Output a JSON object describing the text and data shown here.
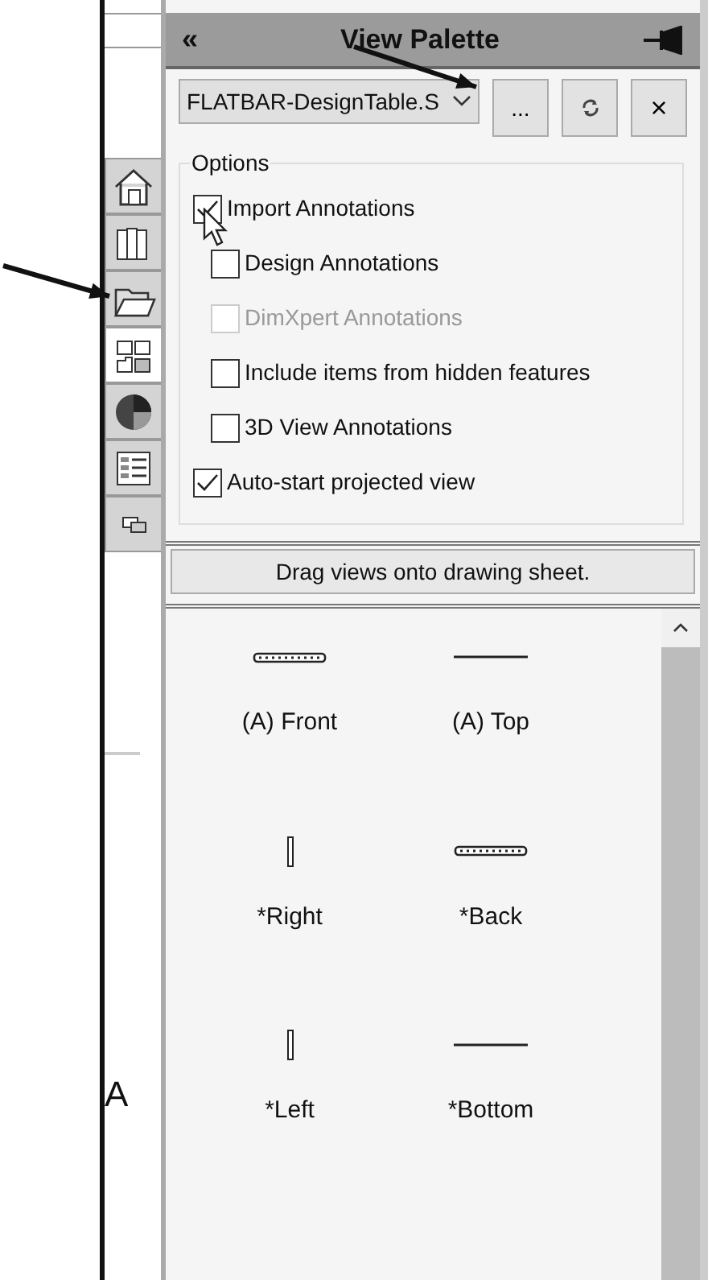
{
  "header": {
    "collapse": "«",
    "title": "View Palette"
  },
  "file_select": {
    "value": "FLATBAR-DesignTable.S"
  },
  "toolbar_buttons": [
    {
      "kind": "browse",
      "label": "..."
    },
    {
      "kind": "refresh"
    },
    {
      "kind": "close",
      "label": "×"
    }
  ],
  "side_tabs": [
    {
      "kind": "home",
      "selected": false
    },
    {
      "kind": "library",
      "selected": false
    },
    {
      "kind": "folder",
      "selected": false
    },
    {
      "kind": "palette",
      "selected": true
    },
    {
      "kind": "appearance",
      "selected": false
    },
    {
      "kind": "properties",
      "selected": false
    },
    {
      "kind": "forum",
      "selected": false
    }
  ],
  "options": {
    "title": "Options",
    "items": [
      {
        "label": "Import Annotations",
        "checked": true,
        "disabled": false,
        "children": [
          {
            "label": "Design Annotations",
            "checked": false,
            "disabled": false
          },
          {
            "label": "DimXpert Annotations",
            "checked": false,
            "disabled": true
          },
          {
            "label": "Include items from hidden features",
            "checked": false,
            "disabled": false
          },
          {
            "label": "3D View Annotations",
            "checked": false,
            "disabled": false
          }
        ]
      },
      {
        "label": "Auto-start projected view",
        "checked": true,
        "disabled": false
      }
    ]
  },
  "hint": "Drag views onto drawing sheet.",
  "views": [
    {
      "label": "(A) Front",
      "kind": "dotted"
    },
    {
      "label": "(A) Top",
      "kind": "line"
    },
    {
      "label": "*Right",
      "kind": "slab"
    },
    {
      "label": "*Back",
      "kind": "dotted"
    },
    {
      "label": "*Left",
      "kind": "slab"
    },
    {
      "label": "*Bottom",
      "kind": "line"
    }
  ],
  "sheet": {
    "label": "A"
  }
}
